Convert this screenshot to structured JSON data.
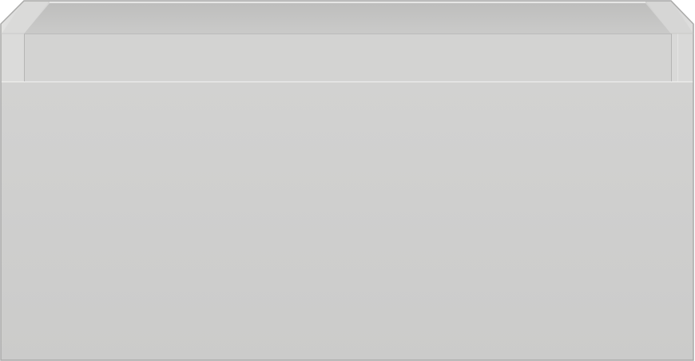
{
  "product": {
    "name": "",
    "finish_color": "#cfcfce",
    "drawer_count": 1,
    "handleless": true
  },
  "colors": {
    "background": "#ffffff",
    "front_top": "#d2d2d1",
    "front_bottom": "#cbcbca",
    "rim": "#d8d8d7",
    "inner_back": "#c2c2c1",
    "inner_floor": "#d4d4d3",
    "side_panel": "#dcdcdb",
    "edge_line": "#a9a9a8",
    "highlight": "#eeeeed"
  }
}
